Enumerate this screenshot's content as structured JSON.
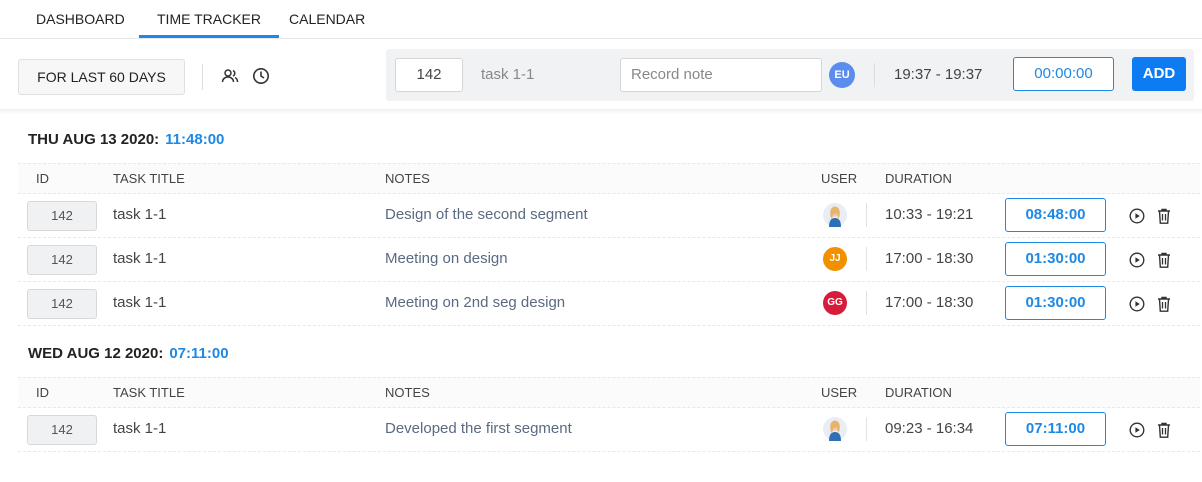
{
  "nav": {
    "tabs": [
      {
        "label": "DASHBOARD",
        "active": false
      },
      {
        "label": "TIME TRACKER",
        "active": true
      },
      {
        "label": "CALENDAR",
        "active": false
      }
    ]
  },
  "toolbar": {
    "range_label": "FOR LAST 60 DAYS",
    "icons": [
      "users-icon",
      "clock-icon"
    ]
  },
  "entry": {
    "id_value": "142",
    "task_title": "task 1-1",
    "note_placeholder": "Record note",
    "user_initials": "EU",
    "time_range": "19:37 - 19:37",
    "duration": "00:00:00",
    "add_label": "ADD"
  },
  "headers": {
    "id": "ID",
    "task_title": "TASK TITLE",
    "notes": "NOTES",
    "user": "USER",
    "duration": "DURATION"
  },
  "days": [
    {
      "date": "THU AUG 13 2020:",
      "total": "11:48:00",
      "rows": [
        {
          "id": "142",
          "task": "task 1-1",
          "note": "Design of the second segment",
          "user": {
            "type": "photo",
            "initials": ""
          },
          "time": "10:33 - 19:21",
          "duration": "08:48:00"
        },
        {
          "id": "142",
          "task": "task 1-1",
          "note": "Meeting on design",
          "user": {
            "type": "initials",
            "initials": "JJ",
            "color": "#f29100"
          },
          "time": "17:00 - 18:30",
          "duration": "01:30:00"
        },
        {
          "id": "142",
          "task": "task 1-1",
          "note": "Meeting on 2nd seg design",
          "user": {
            "type": "initials",
            "initials": "GG",
            "color": "#d71c3b"
          },
          "time": "17:00 - 18:30",
          "duration": "01:30:00"
        }
      ]
    },
    {
      "date": "WED AUG 12 2020:",
      "total": "07:11:00",
      "rows": [
        {
          "id": "142",
          "task": "task 1-1",
          "note": "Developed the first segment",
          "user": {
            "type": "photo",
            "initials": ""
          },
          "time": "09:23 - 16:34",
          "duration": "07:11:00"
        }
      ]
    }
  ],
  "colors": {
    "accent": "#1e88e5",
    "add_button": "#0d7bf2",
    "entry_bar": "#f1f2f4"
  }
}
